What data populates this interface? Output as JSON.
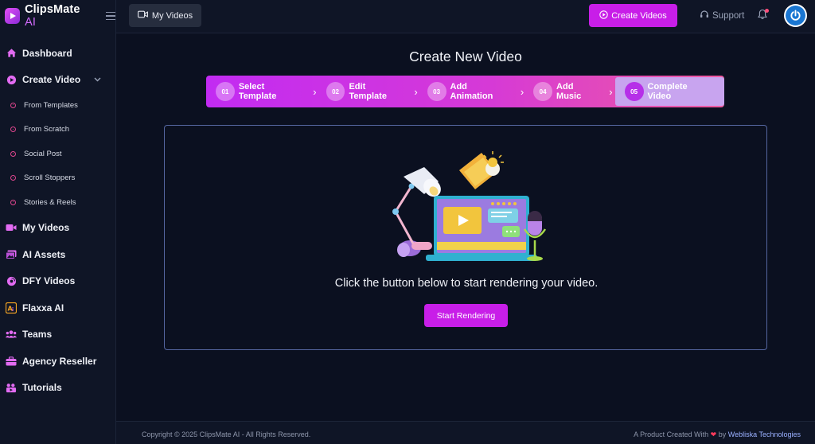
{
  "app": {
    "name": "ClipsMate",
    "name_suffix": "AI"
  },
  "sidebar": {
    "items": [
      {
        "label": "Dashboard",
        "icon": "home-icon"
      },
      {
        "label": "Create Video",
        "icon": "play-circle-icon"
      },
      {
        "label": "My Videos",
        "icon": "video-camera-icon"
      },
      {
        "label": "AI Assets",
        "icon": "images-icon"
      },
      {
        "label": "DFY Videos",
        "icon": "disc-icon"
      },
      {
        "label": "Flaxxa AI",
        "icon": "ai-icon"
      },
      {
        "label": "Teams",
        "icon": "users-icon"
      },
      {
        "label": "Agency Reseller",
        "icon": "briefcase-icon"
      },
      {
        "label": "Tutorials",
        "icon": "tutorials-icon"
      }
    ],
    "create_video_sub": [
      "From Templates",
      "From Scratch",
      "Social Post",
      "Scroll Stoppers",
      "Stories & Reels"
    ]
  },
  "topbar": {
    "my_videos_label": "My Videos",
    "create_videos_label": "Create Videos",
    "support_label": "Support"
  },
  "main": {
    "title": "Create New Video",
    "steps": [
      {
        "num": "01",
        "label": "Select Template"
      },
      {
        "num": "02",
        "label": "Edit Template"
      },
      {
        "num": "03",
        "label": "Add Animation"
      },
      {
        "num": "04",
        "label": "Add Music"
      },
      {
        "num": "05",
        "label": "Complete Video"
      }
    ],
    "active_step": 5,
    "prompt": "Click the button below to start rendering your video.",
    "render_button_label": "Start Rendering"
  },
  "footer": {
    "copyright": "Copyright © 2025 ClipsMate AI - All Rights Reserved.",
    "created_with_prefix": "A Product Created With",
    "created_with_by": "by",
    "company": "Webliska Technologies"
  },
  "colors": {
    "accent": "#c81ee8",
    "background": "#0b1020",
    "sidebar": "#0f1526",
    "heart": "#ff3b5c"
  }
}
